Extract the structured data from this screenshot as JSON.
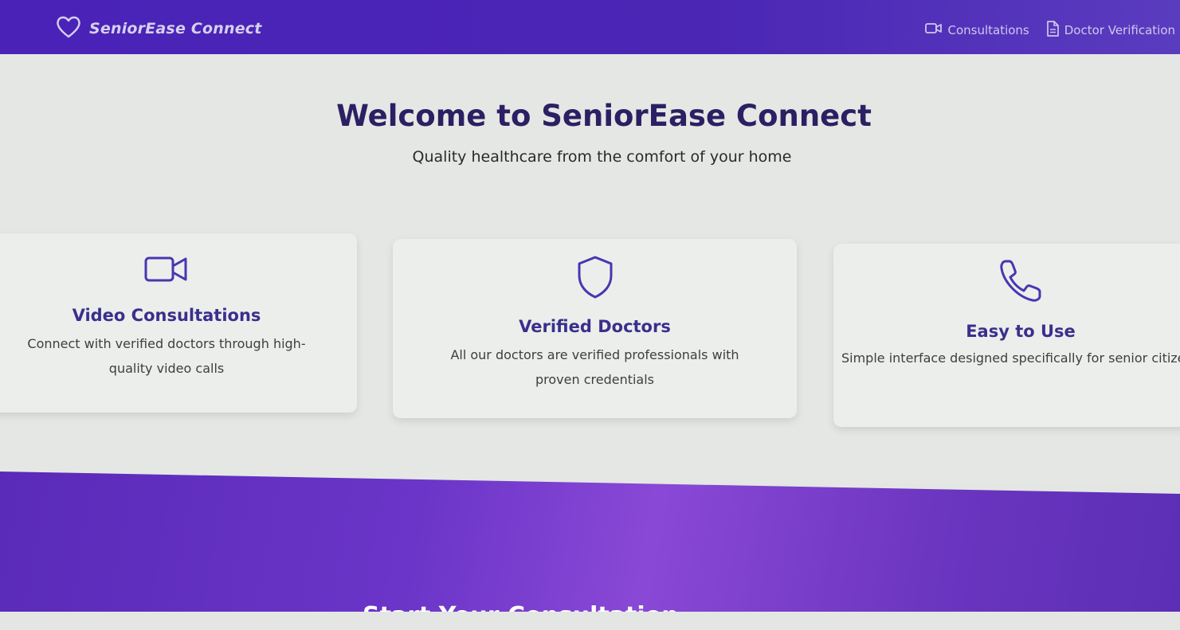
{
  "navbar": {
    "brand_name": "SeniorEase Connect",
    "links": [
      {
        "label": "Consultations",
        "icon": "video-icon"
      },
      {
        "label": "Doctor Verification",
        "icon": "document-icon"
      }
    ]
  },
  "hero": {
    "title": "Welcome to SeniorEase Connect",
    "subtitle": "Quality healthcare from the comfort of your home"
  },
  "features": [
    {
      "icon": "video-camera-icon",
      "title": "Video Consultations",
      "description": "Connect with verified doctors through high-quality video calls"
    },
    {
      "icon": "shield-icon",
      "title": "Verified Doctors",
      "description": "All our doctors are verified professionals with proven credentials"
    },
    {
      "icon": "phone-icon",
      "title": "Easy to Use",
      "description": "Simple interface designed specifically for senior citizens"
    }
  ],
  "cta": {
    "title": "Start Your Consultation"
  },
  "colors": {
    "primary": "#4b26b5",
    "accent": "#4a35b0",
    "heading": "#2c1f63"
  }
}
